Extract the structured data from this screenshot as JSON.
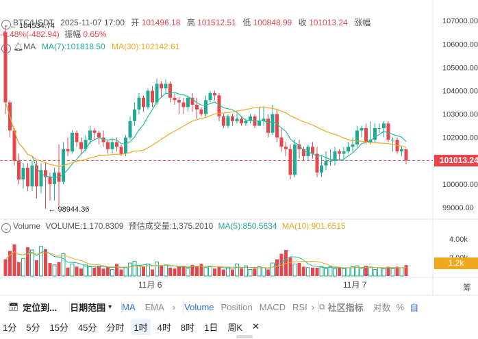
{
  "header": {
    "symbol": "BTC/USDT",
    "datetime": "2025-11-07 17:00",
    "open_label": "开",
    "open": "101496.18",
    "high_label": "高",
    "high": "101512.51",
    "low_label": "低",
    "low": "100848.99",
    "close_label": "收",
    "close": "101013.24",
    "change_label": "涨幅",
    "change": "-0.48%(-482.94)",
    "amplitude_label": "振幅",
    "amplitude": "0.65%"
  },
  "ma_legend": {
    "label": "MA",
    "ma7": "MA(7):101818.50",
    "ma30": "MA(30):102142.61"
  },
  "volume_legend": {
    "label": "Volume",
    "volume": "VOLUME:1,170.8309",
    "estimated": "预估成交量:1,375.2010",
    "ma5": "MA(5):850.5634",
    "ma10": "MA(10):901.6515"
  },
  "price_axis": [
    "107000.00",
    "106000.00",
    "105000.00",
    "104000.00",
    "103000.00",
    "102000.00",
    "100000.00",
    "99000.00"
  ],
  "current_price": "101013.24",
  "volume_axis": [
    "4.00k",
    "2.00k"
  ],
  "current_volume": "1.2k",
  "x_axis": [
    "11月 6",
    "11月 7"
  ],
  "annotations": {
    "high": "104534.74",
    "low": "98944.36"
  },
  "toolbar1": {
    "goto": "定位到...",
    "date_range": "日期范围",
    "ma": "MA",
    "ema": "EMA",
    "volume": "Volume",
    "position": "Position",
    "macd": "MACD",
    "rsi": "RSI",
    "community": "社区指标",
    "log": "对数",
    "percent": "%",
    "auto": "自"
  },
  "toolbar2": {
    "timeframes": [
      "1分",
      "5分",
      "15分",
      "45分",
      "分时",
      "1时",
      "4时",
      "8时",
      "1日",
      "周K"
    ],
    "active": "1时",
    "close": "✕"
  },
  "colors": {
    "up": "#22ab94",
    "down": "#e8464d",
    "ma7": "#1fbf9f",
    "ma30": "#f0a81e",
    "accent": "#2e6ce6"
  },
  "chart_data": {
    "type": "candlestick",
    "interval": "1h",
    "candles": [
      [
        106500,
        103500,
        106800,
        103000
      ],
      [
        103500,
        102300,
        103600,
        102000
      ],
      [
        102300,
        101000,
        102400,
        100800
      ],
      [
        101000,
        100200,
        101300,
        100000
      ],
      [
        100200,
        100700,
        100900,
        99800
      ],
      [
        100700,
        99900,
        100900,
        99700
      ],
      [
        99900,
        100800,
        101000,
        99700
      ],
      [
        100800,
        99900,
        101000,
        99400
      ],
      [
        99900,
        100600,
        100900,
        99600
      ],
      [
        100600,
        100300,
        100900,
        98944
      ],
      [
        100300,
        100000,
        100500,
        99300
      ],
      [
        100000,
        100500,
        100700,
        99300
      ],
      [
        100500,
        100100,
        101700,
        99000
      ],
      [
        100100,
        101500,
        101800,
        100000
      ],
      [
        101500,
        101400,
        102000,
        101200
      ],
      [
        101400,
        102200,
        102300,
        101300
      ],
      [
        102200,
        101800,
        102300,
        101600
      ],
      [
        101800,
        101500,
        102000,
        101300
      ],
      [
        101500,
        101900,
        102100,
        101400
      ],
      [
        101900,
        102300,
        102500,
        101700
      ],
      [
        102300,
        102200,
        102400,
        101900
      ],
      [
        102200,
        102000,
        102300,
        101700
      ],
      [
        102000,
        101800,
        102300,
        101600
      ],
      [
        101800,
        101500,
        101900,
        101300
      ],
      [
        101500,
        101800,
        101900,
        101300
      ],
      [
        101800,
        101600,
        102000,
        101400
      ],
      [
        101600,
        101300,
        101700,
        101200
      ],
      [
        101300,
        102000,
        102100,
        101200
      ],
      [
        102000,
        102700,
        102900,
        101900
      ],
      [
        102700,
        103200,
        103500,
        102500
      ],
      [
        103200,
        103700,
        103900,
        103000
      ],
      [
        103700,
        103300,
        103800,
        103100
      ],
      [
        103300,
        104000,
        104100,
        103200
      ],
      [
        104000,
        103500,
        104200,
        103300
      ],
      [
        103500,
        104300,
        104535,
        103400
      ],
      [
        104300,
        104100,
        104400,
        103700
      ],
      [
        104100,
        104300,
        104500,
        103900
      ],
      [
        104300,
        103700,
        104400,
        103500
      ],
      [
        103700,
        103600,
        103900,
        103400
      ],
      [
        103600,
        103500,
        103700,
        103000
      ],
      [
        103500,
        103300,
        103700,
        103000
      ],
      [
        103300,
        103700,
        103800,
        103100
      ],
      [
        103700,
        103400,
        103900,
        103100
      ],
      [
        103400,
        103200,
        103700,
        102800
      ],
      [
        103200,
        103000,
        103300,
        102900
      ],
      [
        103000,
        103600,
        103800,
        102900
      ],
      [
        103600,
        103900,
        104000,
        103500
      ],
      [
        103900,
        103800,
        104000,
        103600
      ],
      [
        103800,
        102900,
        103900,
        102700
      ],
      [
        102900,
        102500,
        103000,
        102400
      ],
      [
        102500,
        102900,
        103000,
        102400
      ],
      [
        102900,
        102700,
        103000,
        102500
      ],
      [
        102700,
        102800,
        103000,
        102600
      ],
      [
        102800,
        102600,
        102900,
        102500
      ],
      [
        102600,
        102700,
        102800,
        102500
      ],
      [
        102700,
        102900,
        103000,
        102600
      ],
      [
        102900,
        102500,
        103000,
        102400
      ],
      [
        102500,
        102700,
        103300,
        102500
      ],
      [
        102700,
        102800,
        103300,
        102500
      ],
      [
        102800,
        102200,
        103000,
        102000
      ],
      [
        102200,
        103000,
        103400,
        102100
      ],
      [
        103000,
        102000,
        103200,
        101800
      ],
      [
        102000,
        101600,
        102400,
        101400
      ],
      [
        101600,
        101500,
        101800,
        101200
      ],
      [
        101500,
        100400,
        101700,
        100200
      ],
      [
        100400,
        101700,
        101900,
        100300
      ],
      [
        101700,
        101500,
        101900,
        101100
      ],
      [
        101500,
        101200,
        101600,
        101000
      ],
      [
        101200,
        101600,
        101700,
        101000
      ],
      [
        101600,
        101300,
        101800,
        101100
      ],
      [
        101300,
        100500,
        101600,
        100300
      ],
      [
        100500,
        100800,
        101200,
        100300
      ],
      [
        100800,
        101000,
        101400,
        100600
      ],
      [
        101000,
        101000,
        101500,
        100800
      ],
      [
        101000,
        101400,
        101600,
        100800
      ],
      [
        101400,
        101300,
        101500,
        101000
      ],
      [
        101300,
        101400,
        101600,
        101000
      ],
      [
        101400,
        101600,
        101800,
        101300
      ],
      [
        101600,
        101700,
        102000,
        101400
      ],
      [
        101700,
        102300,
        102500,
        101600
      ],
      [
        102300,
        102400,
        102500,
        102000
      ],
      [
        102400,
        101800,
        102600,
        101700
      ],
      [
        101800,
        101900,
        102700,
        101700
      ],
      [
        101900,
        102400,
        102600,
        101800
      ],
      [
        102400,
        102400,
        102600,
        102200
      ],
      [
        102400,
        102600,
        102700,
        102000
      ],
      [
        102600,
        101900,
        102700,
        101800
      ],
      [
        101900,
        101900,
        102000,
        101400
      ],
      [
        101900,
        101400,
        102000,
        101300
      ],
      [
        101400,
        101496,
        101600,
        101200
      ],
      [
        101496,
        101013,
        101513,
        100849
      ]
    ],
    "volumes": [
      1800,
      2700,
      3400,
      1500,
      1900,
      3100,
      2800,
      1700,
      3200,
      2900,
      1400,
      1200,
      1500,
      2400,
      900,
      1300,
      1000,
      800,
      1200,
      1000,
      900,
      1100,
      800,
      1000,
      700,
      1300,
      700,
      900,
      1400,
      1600,
      1100,
      1000,
      1300,
      700,
      1500,
      1100,
      1200,
      900,
      800,
      1000,
      1100,
      800,
      1200,
      1000,
      1300,
      900,
      1000,
      800,
      1000,
      700,
      900,
      700,
      1300,
      800,
      1100,
      700,
      800,
      1000,
      900,
      700,
      1400,
      1800,
      2400,
      2800,
      2000,
      1300,
      1400,
      1000,
      900,
      900,
      900,
      1000,
      800,
      1000,
      800,
      900,
      800,
      900,
      1000,
      1100,
      800,
      1100,
      900,
      700,
      900,
      800,
      1000,
      800,
      1000,
      900,
      1171
    ],
    "x_labels": [
      "11月 6",
      "11月 7"
    ],
    "ylim": [
      98500,
      107300
    ],
    "volume_ylim": [
      0,
      4800
    ]
  }
}
